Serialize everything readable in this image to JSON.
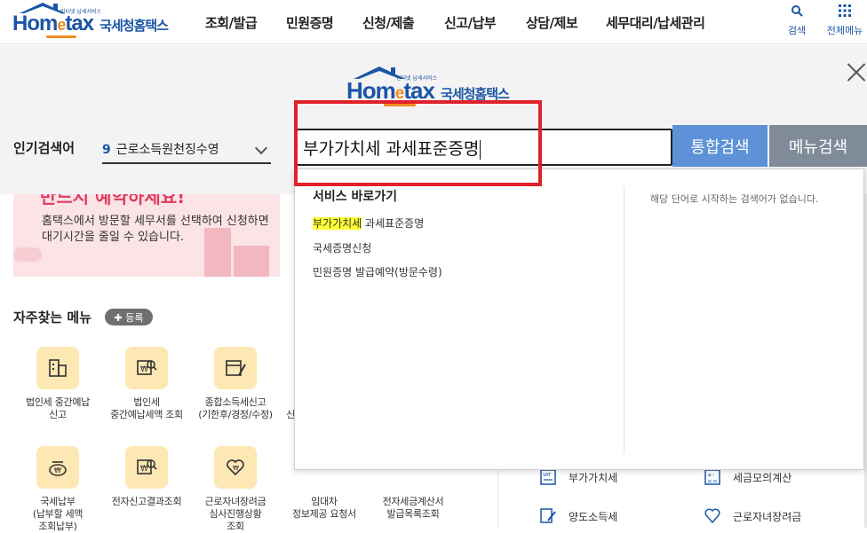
{
  "header": {
    "logo": {
      "word_pre": "Hom",
      "word_e": "e",
      "word_post": "tax",
      "tagline": "인터넷 납세서비스",
      "korean": "국세청홈택스"
    },
    "nav": [
      "조회/발급",
      "민원증명",
      "신청/제출",
      "신고/납부",
      "상담/제보",
      "세무대리/납세관리"
    ],
    "search_label": "검색",
    "all_menu_label": "전체메뉴"
  },
  "search": {
    "popular_label": "인기검색어",
    "popular_rank": "9",
    "popular_term": "근로소득원천징수영",
    "query": "부가가치세 과세표준증명",
    "integrated_button": "통합검색",
    "menu_button": "메뉴검색"
  },
  "dropdown": {
    "title": "서비스 바로가기",
    "first_item_highlight": "부가가치세",
    "first_item_rest": " 과세표준증명",
    "items": [
      "국세증명신청",
      "민원증명 발급예약(방문수령)"
    ],
    "no_result_message": "해당 단어로 시작하는 검색어가 없습니다."
  },
  "banner": {
    "heading": "반드시 예약하세요!",
    "text_line1": "홈택스에서 방문할 세무서를 선택하여 신청하면",
    "text_line2": "대기시간을 줄일 수 있습니다."
  },
  "favorites": {
    "title": "자주찾는 메뉴",
    "add_label": "등록",
    "row1": [
      {
        "line1": "법인세 중간예납",
        "line2": "신고"
      },
      {
        "line1": "법인세",
        "line2": "중간예납세액 조회"
      },
      {
        "line1": "종합소득세신고",
        "line2": "(기한후/경정/수정)"
      },
      {
        "line1": "신",
        "line2": ""
      }
    ],
    "row2": [
      {
        "line1": "국세납부",
        "line2": "(납부할 세액",
        "line3": "조회납부)"
      },
      {
        "line1": "전자신고결과조회",
        "line2": "",
        "line3": ""
      },
      {
        "line1": "근로자녀장려금",
        "line2": "심사진행상황",
        "line3": "조회"
      },
      {
        "line1": "임대차",
        "line2": "정보제공 요청서",
        "line3": ""
      },
      {
        "line1": "전자세금계산서",
        "line2": "발급목록조회",
        "line3": ""
      }
    ]
  },
  "right_links": [
    {
      "label": "부가가치세",
      "icon": "vat-icon"
    },
    {
      "label": "세금모의계산",
      "icon": "calculator-icon"
    },
    {
      "label": "양도소득세",
      "icon": "document-pen-icon"
    },
    {
      "label": "근로자녀장려금",
      "icon": "heart-hands-icon"
    }
  ]
}
